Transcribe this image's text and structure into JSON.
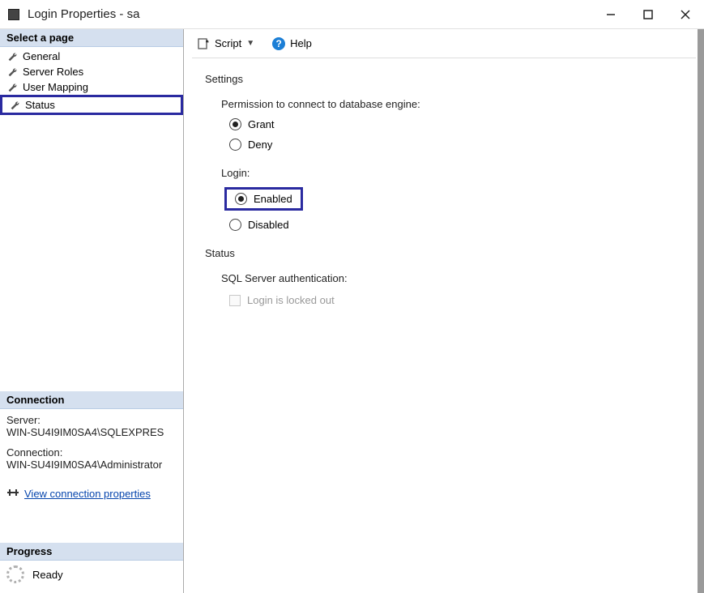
{
  "window": {
    "title": "Login Properties - sa"
  },
  "left": {
    "select_page": "Select a page",
    "pages": [
      {
        "label": "General"
      },
      {
        "label": "Server Roles"
      },
      {
        "label": "User Mapping"
      },
      {
        "label": "Status"
      }
    ],
    "connection_head": "Connection",
    "server_label": "Server:",
    "server_value": "WIN-SU4I9IM0SA4\\SQLEXPRES",
    "connection_label": "Connection:",
    "connection_value": "WIN-SU4I9IM0SA4\\Administrator",
    "view_conn_props": "View connection properties",
    "progress_head": "Progress",
    "progress_status": "Ready"
  },
  "toolbar": {
    "script_label": "Script",
    "help_label": "Help"
  },
  "main": {
    "settings": "Settings",
    "perm_label": "Permission to connect to database engine:",
    "grant": "Grant",
    "deny": "Deny",
    "login_label": "Login:",
    "enabled": "Enabled",
    "disabled": "Disabled",
    "status": "Status",
    "sqlauth": "SQL Server authentication:",
    "locked_out": "Login is locked out"
  }
}
